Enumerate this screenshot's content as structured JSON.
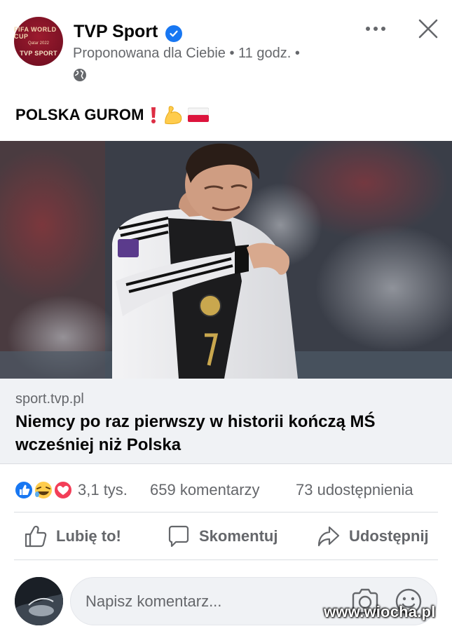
{
  "post": {
    "page_name": "TVP Sport",
    "avatar": {
      "line1": "FIFA WORLD CUP",
      "line2": "Qatar 2022",
      "brand": "TVP SPORT"
    },
    "meta": "Proponowana dla Ciebie • 11 godz. •",
    "text": "POLSKA GUROM",
    "emojis": [
      "exclamation-icon",
      "flexed-biceps-icon",
      "polish-flag-icon"
    ]
  },
  "link": {
    "domain": "sport.tvp.pl",
    "title": "Niemcy po raz pierwszy w historii kończą MŚ wcześniej niż Polska"
  },
  "stats": {
    "reactions": "3,1 tys.",
    "comments": "659 komentarzy",
    "shares": "73 udostępnienia"
  },
  "actions": {
    "like": "Lubię to!",
    "comment": "Skomentuj",
    "share": "Udostępnij"
  },
  "composer": {
    "placeholder": "Napisz komentarz..."
  },
  "watermark": "www.wiocha.pl",
  "colors": {
    "accent": "#1877f2",
    "secondary_text": "#65676b",
    "surface": "#f0f2f5"
  }
}
